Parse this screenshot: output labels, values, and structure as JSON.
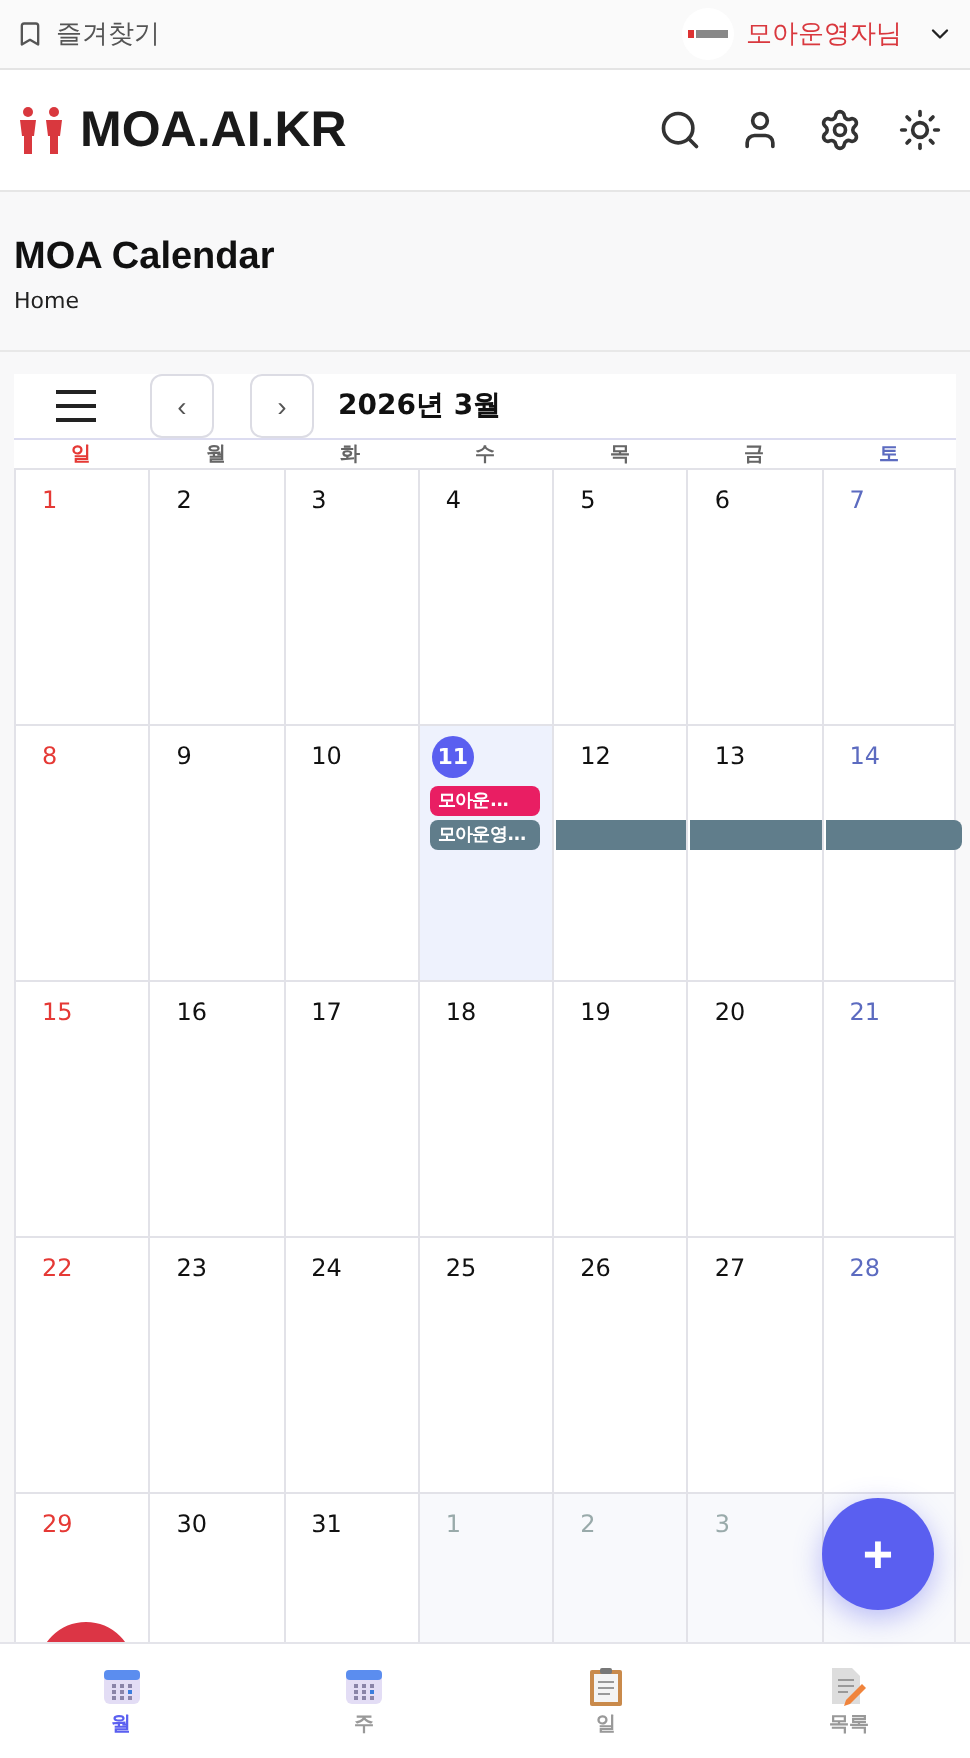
{
  "top_bar": {
    "bookmark": "즐겨찾기",
    "user": "모아운영자님"
  },
  "header": {
    "logo": "MOA.AI.KR"
  },
  "page": {
    "title": "MOA Calendar",
    "breadcrumb": "Home"
  },
  "calendar": {
    "month": "2026년 3월",
    "prev": "‹",
    "next": "›",
    "weekdays": [
      "일",
      "월",
      "화",
      "수",
      "목",
      "금",
      "토"
    ],
    "weeks": [
      {
        "days": [
          {
            "n": "1",
            "other_month": false,
            "selected": false
          },
          {
            "n": "2",
            "other_month": false,
            "selected": false
          },
          {
            "n": "3",
            "other_month": false,
            "selected": false
          },
          {
            "n": "4",
            "other_month": false,
            "selected": false
          },
          {
            "n": "5",
            "other_month": false,
            "selected": false
          },
          {
            "n": "6",
            "other_month": false,
            "selected": false
          },
          {
            "n": "7",
            "other_month": false,
            "selected": false
          }
        ]
      },
      {
        "days": [
          {
            "n": "8",
            "other_month": false,
            "selected": false
          },
          {
            "n": "9",
            "other_month": false,
            "selected": false
          },
          {
            "n": "10",
            "other_month": false,
            "selected": false
          },
          {
            "n": "11",
            "other_month": false,
            "selected": true,
            "events": [
              {
                "kind": "event",
                "label": "모아운...",
                "color": "#e91e63"
              },
              {
                "kind": "event",
                "label": "모아운영...",
                "color": "#607d8b"
              }
            ]
          },
          {
            "n": "12",
            "other_month": false,
            "selected": false,
            "events": [
              {
                "kind": "gap"
              },
              {
                "kind": "continuation",
                "color": "#607d8b"
              }
            ]
          },
          {
            "n": "13",
            "other_month": false,
            "selected": false,
            "events": [
              {
                "kind": "gap"
              },
              {
                "kind": "continuation",
                "color": "#607d8b"
              }
            ]
          },
          {
            "n": "14",
            "other_month": false,
            "selected": false,
            "events": [
              {
                "kind": "gap"
              },
              {
                "kind": "end",
                "color": "#607d8b"
              }
            ]
          }
        ]
      },
      {
        "days": [
          {
            "n": "15",
            "other_month": false,
            "selected": false
          },
          {
            "n": "16",
            "other_month": false,
            "selected": false
          },
          {
            "n": "17",
            "other_month": false,
            "selected": false
          },
          {
            "n": "18",
            "other_month": false,
            "selected": false
          },
          {
            "n": "19",
            "other_month": false,
            "selected": false
          },
          {
            "n": "20",
            "other_month": false,
            "selected": false
          },
          {
            "n": "21",
            "other_month": false,
            "selected": false
          }
        ]
      },
      {
        "days": [
          {
            "n": "22",
            "other_month": false,
            "selected": false
          },
          {
            "n": "23",
            "other_month": false,
            "selected": false
          },
          {
            "n": "24",
            "other_month": false,
            "selected": false
          },
          {
            "n": "25",
            "other_month": false,
            "selected": false
          },
          {
            "n": "26",
            "other_month": false,
            "selected": false
          },
          {
            "n": "27",
            "other_month": false,
            "selected": false
          },
          {
            "n": "28",
            "other_month": false,
            "selected": false
          }
        ]
      },
      {
        "days": [
          {
            "n": "29",
            "other_month": false,
            "selected": false
          },
          {
            "n": "30",
            "other_month": false,
            "selected": false
          },
          {
            "n": "31",
            "other_month": false,
            "selected": false
          },
          {
            "n": "1",
            "other_month": true,
            "selected": false
          },
          {
            "n": "2",
            "other_month": true,
            "selected": false
          },
          {
            "n": "3",
            "other_month": true,
            "selected": false
          }
        ]
      }
    ]
  },
  "fab": {
    "label": "+"
  },
  "bottom_nav": [
    {
      "label": "월",
      "kind": "month",
      "selected": true
    },
    {
      "label": "주",
      "kind": "week",
      "selected": false
    },
    {
      "label": "일",
      "kind": "day",
      "selected": false
    },
    {
      "label": "목록",
      "kind": "list",
      "selected": false
    }
  ]
}
